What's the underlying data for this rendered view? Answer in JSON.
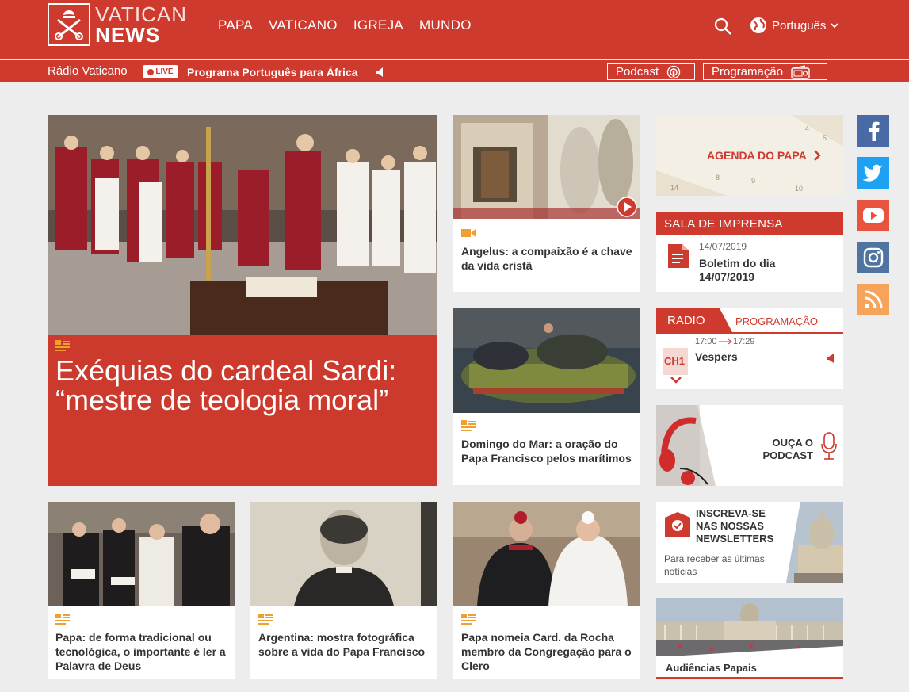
{
  "header": {
    "logo_line1": "VATICAN",
    "logo_line2": "NEWS",
    "nav": [
      "PAPA",
      "VATICANO",
      "IGREJA",
      "MUNDO"
    ],
    "language": "Português"
  },
  "radiobar": {
    "label": "Rádio Vaticano",
    "live": "LIVE",
    "program": "Programa Português para África",
    "podcast": "Podcast",
    "programacao": "Programação"
  },
  "hero": {
    "title": "Exéquias do cardeal Sardi: “mestre de teologia moral”"
  },
  "articles": {
    "angelus": "Angelus: a compaixão é a chave da vida cristã",
    "domingo": "Domingo do Mar: a oração do Papa Francisco pelos marítimos",
    "palavra": "Papa: de forma tradicional ou tecnológica, o importante é ler a Palavra de Deus",
    "argentina": "Argentina: mostra fotográfica sobre a vida do Papa Francisco",
    "rocha": "Papa nomeia Card. da Rocha membro da Congregação para o Clero"
  },
  "sidebar": {
    "agenda": "AGENDA DO PAPA",
    "sala_title": "SALA DE IMPRENSA",
    "sala_date": "14/07/2019",
    "sala_item": "Boletim do dia 14/07/2019",
    "radio_tab": "RADIO",
    "prog_tab": "PROGRAMAÇÃO",
    "time_start": "17:00",
    "time_end": "17:29",
    "channel": "CH1",
    "show": "Vespers",
    "podcast_promo": "OUÇA O PODCAST",
    "newsletter_title": "INSCREVA-SE NAS NOSSAS NEWSLETTERS",
    "newsletter_sub": "Para receber as últimas notícias",
    "audiencias": "Audiências Papais"
  },
  "colors": {
    "brand_red": "#cf3a2f",
    "accent_orange": "#f0a030",
    "facebook": "#4a6aa5",
    "twitter": "#1da1f2",
    "youtube": "#e8533f",
    "instagram": "#4f74a0",
    "rss": "#f5a45a"
  }
}
